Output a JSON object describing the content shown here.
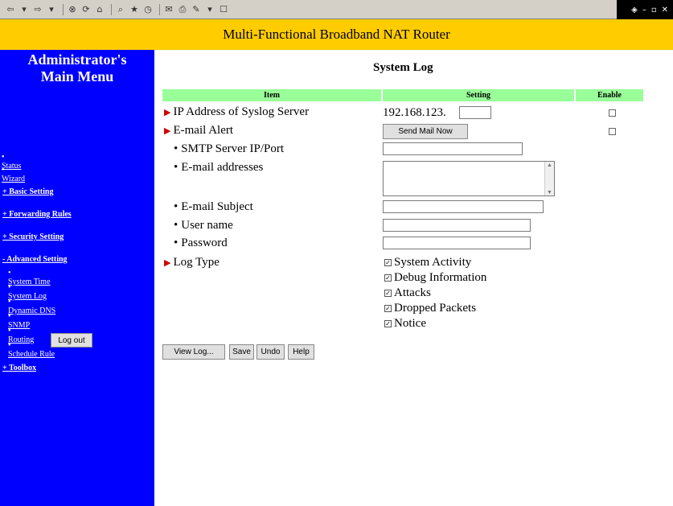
{
  "header": {
    "title": "Multi-Functional Broadband NAT Router"
  },
  "sidebar": {
    "title": "Administrator's Main Menu",
    "links": [
      {
        "label": "Status",
        "kind": "top"
      },
      {
        "label": "Wizard",
        "kind": "top"
      },
      {
        "label": "+ Basic Setting",
        "kind": "sec"
      },
      {
        "label": "+ Forwarding Rules",
        "kind": "sec"
      },
      {
        "label": "+ Security Setting",
        "kind": "sec"
      },
      {
        "label": "- Advanced Setting",
        "kind": "sec"
      },
      {
        "label": "System Time",
        "kind": "sub"
      },
      {
        "label": "System Log",
        "kind": "sub"
      },
      {
        "label": "Dynamic DNS",
        "kind": "sub"
      },
      {
        "label": "SNMP",
        "kind": "sub"
      },
      {
        "label": "Routing",
        "kind": "sub"
      },
      {
        "label": "Schedule Rule",
        "kind": "sub"
      },
      {
        "label": "+ Toolbox",
        "kind": "sec"
      }
    ],
    "logout_label": "Log out"
  },
  "main": {
    "title": "System Log",
    "columns": {
      "item": "Item",
      "setting": "Setting",
      "enable": "Enable"
    },
    "syslog_label": "IP Address of Syslog Server",
    "syslog_prefix": "192.168.123.",
    "email_alert_label": "E-mail Alert",
    "send_mail_label": "Send Mail Now",
    "smtp_label": "SMTP Server IP/Port",
    "emails_label": "E-mail addresses",
    "subject_label": "E-mail Subject",
    "username_label": "User name",
    "password_label": "Password",
    "log_type_label": "Log Type",
    "log_types": [
      "System Activity",
      "Debug Information",
      "Attacks",
      "Dropped Packets",
      "Notice"
    ],
    "buttons": {
      "view_log": "View Log...",
      "save": "Save",
      "undo": "Undo",
      "help": "Help"
    }
  }
}
